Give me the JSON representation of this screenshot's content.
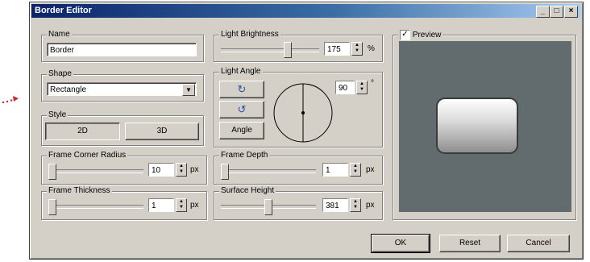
{
  "window": {
    "title": "Border Editor",
    "minimize": "_",
    "maximize": "□",
    "close": "×"
  },
  "name_group": {
    "label": "Name",
    "value": "Border"
  },
  "shape_group": {
    "label": "Shape",
    "selected": "Rectangle"
  },
  "style_group": {
    "label": "Style",
    "btn_2d": "2D",
    "btn_3d": "3D"
  },
  "light_brightness": {
    "label": "Light Brightness",
    "value": "175",
    "unit": "%",
    "level": 0.7
  },
  "light_angle": {
    "label": "Light Angle",
    "value": "90",
    "unit": "°",
    "rotate_cw": "↻",
    "rotate_ccw": "↺",
    "angle_btn": "Angle"
  },
  "preview": {
    "label": "Preview",
    "checked": "✓",
    "colors": {
      "background": "#626c6e"
    }
  },
  "frame_corner_radius": {
    "label": "Frame Corner Radius",
    "value": "10",
    "unit": "px",
    "level": 0.0
  },
  "frame_depth": {
    "label": "Frame Depth",
    "value": "1",
    "unit": "px",
    "level": 0.0
  },
  "frame_thickness": {
    "label": "Frame Thickness",
    "value": "1",
    "unit": "px",
    "level": 0.0
  },
  "surface_height": {
    "label": "Surface Height",
    "value": "381",
    "unit": "px",
    "level": 0.5
  },
  "buttons": {
    "ok": "OK",
    "reset": "Reset",
    "cancel": "Cancel"
  }
}
